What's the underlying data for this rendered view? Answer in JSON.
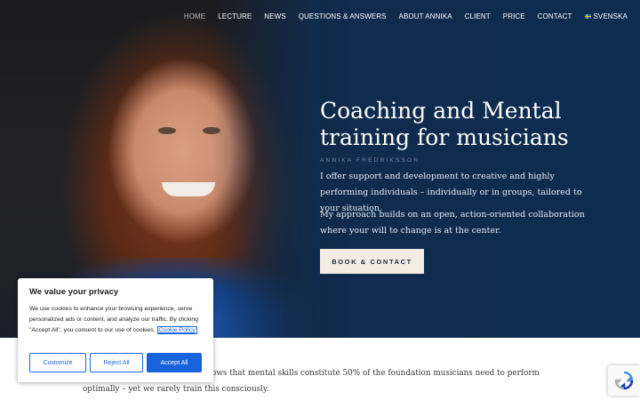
{
  "nav": {
    "items": [
      "HOME",
      "LECTURE",
      "NEWS",
      "QUESTIONS & ANSWERS",
      "ABOUT ANNIKA",
      "CLIENT",
      "PRICE",
      "CONTACT"
    ],
    "language": "SVENSKA",
    "active": "HOME"
  },
  "hero": {
    "title": "Coaching and Mental training for musicians",
    "subtitle": "ANNIKA FREDRIKSSON",
    "paragraph1": "I offer support and development to creative and highly performing individuals – individually or in groups, tailored to your situation.",
    "paragraph2": "My approach builds on an open, action-oriented collaboration where your will to change is at the center.",
    "cta_label": "BOOK & CONTACT"
  },
  "body": {
    "text": "than technical skill. Research shows that mental skills constitute 50% of the foundation musicians need to perform optimally – yet we rarely train this consciously."
  },
  "cookie": {
    "title": "We value your privacy",
    "text": "We use cookies to enhance your browsing experience, serve personalized ads or content, and analyze our traffic. By clicking \"Accept All\", you consent to our use of cookies.",
    "policy_link": "Cookie Policy",
    "customize_label": "Customize",
    "reject_label": "Reject All",
    "accept_label": "Accept All"
  },
  "colors": {
    "hero_bg": "#0f2b4d",
    "cta_bg": "#f4ebe2",
    "accent": "#1863dc"
  },
  "icons": {
    "flag": "swedish-flag-icon",
    "recaptcha": "recaptcha-icon"
  }
}
